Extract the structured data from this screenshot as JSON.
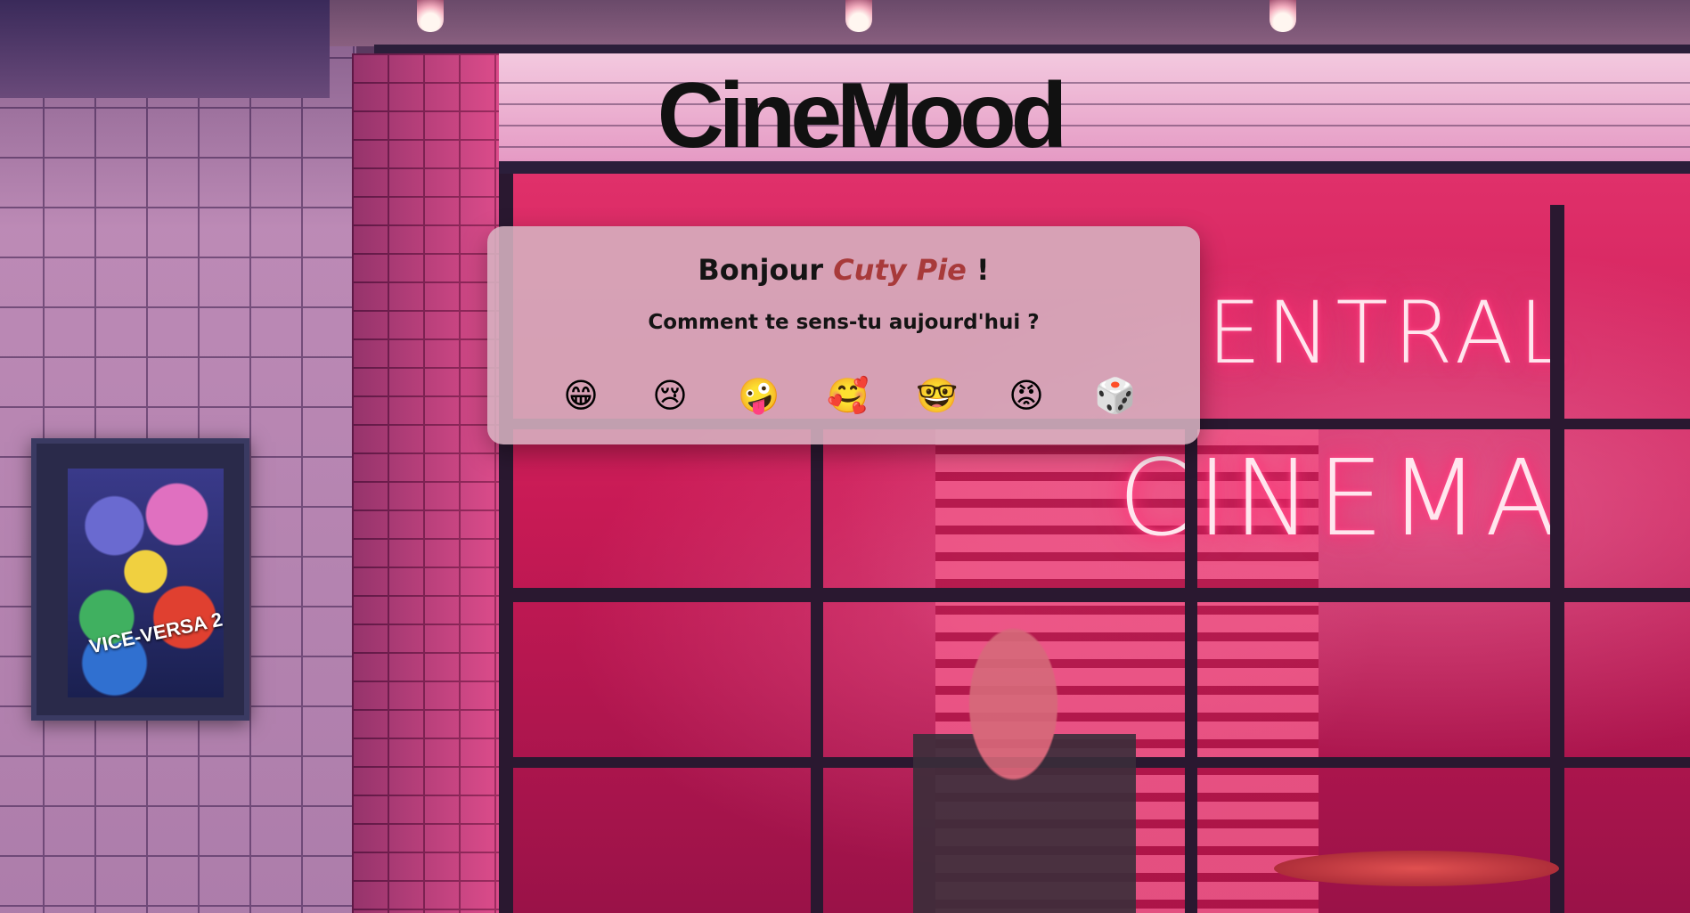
{
  "brand": {
    "logo": "CineMood"
  },
  "greeting": {
    "prefix": "Bonjour",
    "name": "Cuty Pie",
    "suffix": "!"
  },
  "question": "Comment te sens-tu aujourd'hui ?",
  "moods": [
    {
      "emoji": "😁",
      "icon": "grinning-face-icon"
    },
    {
      "emoji": "😢",
      "icon": "crying-face-icon"
    },
    {
      "emoji": "🤪",
      "icon": "zany-face-icon"
    },
    {
      "emoji": "🥰",
      "icon": "smiling-face-with-hearts-icon"
    },
    {
      "emoji": "🤓",
      "icon": "nerd-face-icon"
    },
    {
      "emoji": "😡",
      "icon": "angry-face-icon"
    },
    {
      "emoji": "🎲",
      "icon": "dice-icon"
    }
  ],
  "background": {
    "neon_line1": "ENTRAL",
    "neon_line2": "CINEMA",
    "poster_title": "VICE-VERSA 2"
  },
  "colors": {
    "card_bg": "#d6b2c0",
    "name_accent": "#a83a3a",
    "neon": "#ff2a70"
  }
}
